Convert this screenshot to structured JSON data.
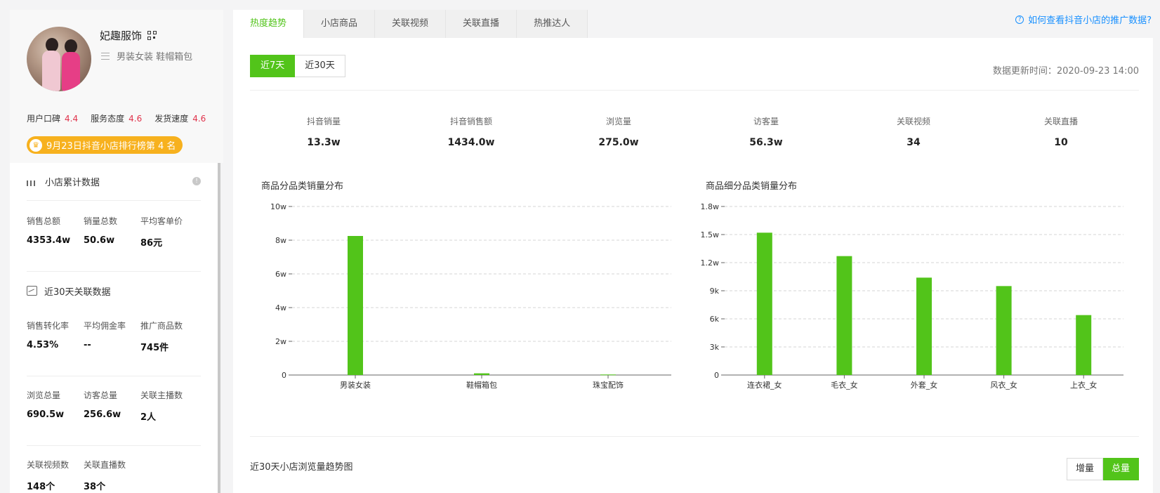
{
  "profile": {
    "shop_name": "妃趣服饰",
    "categories": "男装女装 鞋帽箱包",
    "ratings": [
      {
        "label": "用户口碑",
        "value": "4.4"
      },
      {
        "label": "服务态度",
        "value": "4.6"
      },
      {
        "label": "发货速度",
        "value": "4.6"
      }
    ],
    "rank_badge": "9月23日抖音小店排行榜第 4 名"
  },
  "cumulative": {
    "title": "小店累计数据",
    "stats": [
      {
        "label": "销售总额",
        "value": "4353.4w"
      },
      {
        "label": "销量总数",
        "value": "50.6w"
      },
      {
        "label": "平均客单价",
        "value": "86元"
      }
    ]
  },
  "recent30": {
    "title": "近30天关联数据",
    "row1": [
      {
        "label": "销售转化率",
        "value": "4.53%"
      },
      {
        "label": "平均佣金率",
        "value": "--"
      },
      {
        "label": "推广商品数",
        "value": "745件"
      }
    ],
    "row2": [
      {
        "label": "浏览总量",
        "value": "690.5w"
      },
      {
        "label": "访客总量",
        "value": "256.6w"
      },
      {
        "label": "关联主播数",
        "value": "2人"
      }
    ],
    "row3": [
      {
        "label": "关联视频数",
        "value": "148个"
      },
      {
        "label": "关联直播数",
        "value": "38个"
      }
    ]
  },
  "tabs": [
    "热度趋势",
    "小店商品",
    "关联视频",
    "关联直播",
    "热推达人"
  ],
  "help_link": "如何查看抖音小店的推广数据?",
  "range": {
    "options": [
      "近7天",
      "近30天"
    ],
    "selected": "近7天"
  },
  "update_time": "数据更新时间：2020-09-23 14:00",
  "summary": [
    {
      "label": "抖音销量",
      "value": "13.3w"
    },
    {
      "label": "抖音销售额",
      "value": "1434.0w"
    },
    {
      "label": "浏览量",
      "value": "275.0w"
    },
    {
      "label": "访客量",
      "value": "56.3w"
    },
    {
      "label": "关联视频",
      "value": "34"
    },
    {
      "label": "关联直播",
      "value": "10"
    }
  ],
  "chart_data": [
    {
      "type": "bar",
      "title": "商品分品类销量分布",
      "categories": [
        "男装女装",
        "鞋帽箱包",
        "珠宝配饰"
      ],
      "values": [
        82500,
        1000,
        300
      ],
      "ylim": [
        0,
        100000
      ],
      "yticks": [
        0,
        20000,
        40000,
        60000,
        80000,
        100000
      ],
      "ytick_labels": [
        "0",
        "2w",
        "4w",
        "6w",
        "8w",
        "10w"
      ],
      "grid": true,
      "color": "#52c41a"
    },
    {
      "type": "bar",
      "title": "商品细分品类销量分布",
      "categories": [
        "连衣裙_女",
        "毛衣_女",
        "外套_女",
        "风衣_女",
        "上衣_女"
      ],
      "values": [
        15200,
        12700,
        10400,
        9500,
        6400
      ],
      "ylim": [
        0,
        18000
      ],
      "yticks": [
        0,
        3000,
        6000,
        9000,
        12000,
        15000,
        18000
      ],
      "ytick_labels": [
        "0",
        "3k",
        "6k",
        "9k",
        "1.2w",
        "1.5w",
        "1.8w"
      ],
      "grid": true,
      "color": "#52c41a"
    }
  ],
  "trend": {
    "title": "近30天小店浏览量趋势图",
    "toggle_options": [
      "增量",
      "总量"
    ],
    "toggle_selected": "总量"
  }
}
